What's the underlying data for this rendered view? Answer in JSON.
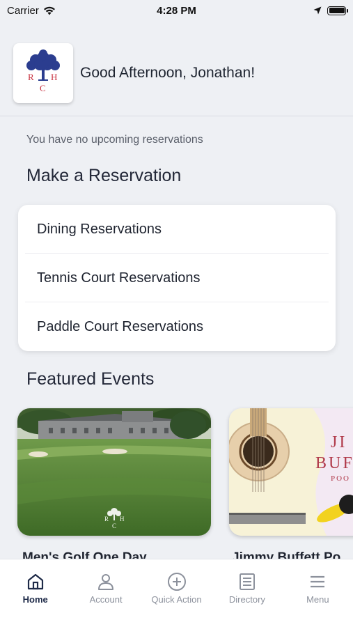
{
  "status_bar": {
    "carrier": "Carrier",
    "time": "4:28 PM"
  },
  "header": {
    "logo_letters": [
      "R",
      "H",
      "C"
    ],
    "greeting": "Good Afternoon, Jonathan!"
  },
  "reservations": {
    "empty_message": "You have no upcoming reservations",
    "section_title": "Make a Reservation",
    "items": [
      {
        "label": "Dining Reservations"
      },
      {
        "label": "Tennis Court Reservations"
      },
      {
        "label": "Paddle Court Reservations"
      }
    ]
  },
  "events": {
    "section_title": "Featured Events",
    "items": [
      {
        "title": "Men's Golf One Day",
        "watermark": [
          "R",
          "H",
          "C"
        ]
      },
      {
        "title": "Jimmy Buffett Po",
        "poster_text": [
          "JI",
          "BUF",
          "POO"
        ]
      }
    ]
  },
  "tab_bar": {
    "tabs": [
      {
        "label": "Home",
        "icon": "home-icon",
        "active": true
      },
      {
        "label": "Account",
        "icon": "account-icon",
        "active": false
      },
      {
        "label": "Quick Action",
        "icon": "plus-circle-icon",
        "active": false
      },
      {
        "label": "Directory",
        "icon": "directory-icon",
        "active": false
      },
      {
        "label": "Menu",
        "icon": "menu-icon",
        "active": false
      }
    ]
  },
  "colors": {
    "background": "#eef0f4",
    "active_tab": "#1e2a48",
    "inactive_tab": "#8c919c",
    "logo_blue": "#2b3d8f",
    "logo_red": "#c8303e"
  }
}
